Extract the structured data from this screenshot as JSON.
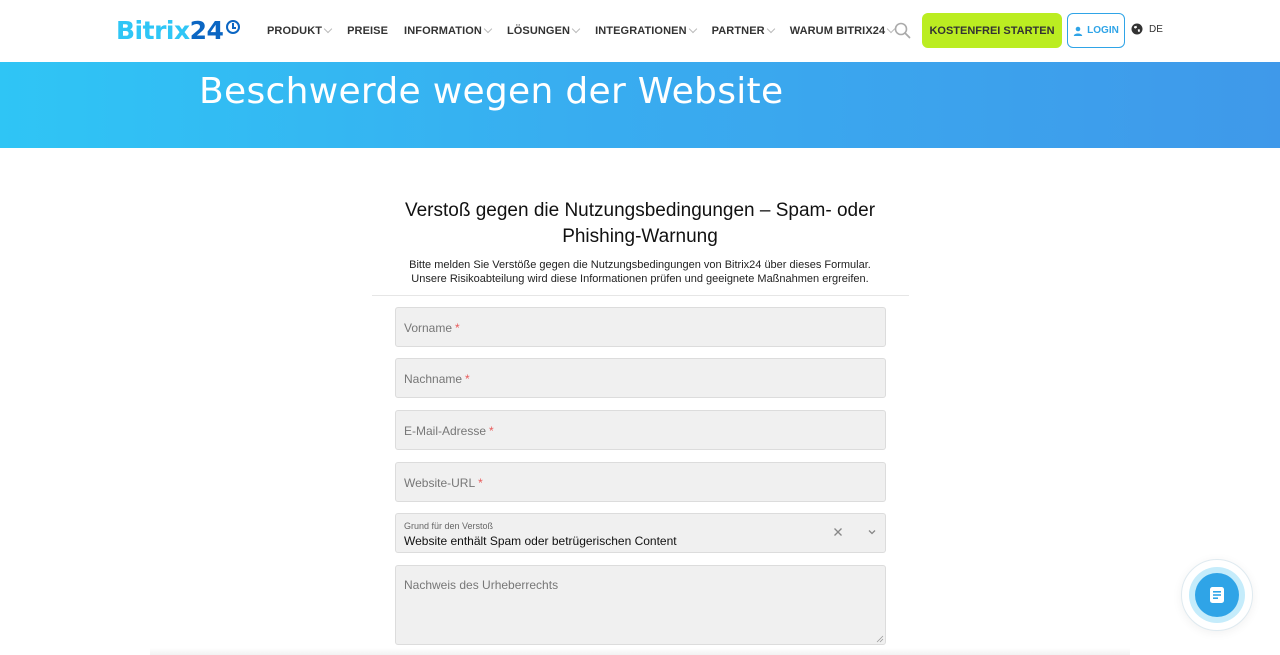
{
  "header": {
    "logo": {
      "part1": "Bitrix",
      "part2": "24"
    },
    "nav": [
      {
        "label": "PRODUKT",
        "dropdown": true
      },
      {
        "label": "PREISE",
        "dropdown": false
      },
      {
        "label": "INFORMATION",
        "dropdown": true
      },
      {
        "label": "LÖSUNGEN",
        "dropdown": true
      },
      {
        "label": "INTEGRATIONEN",
        "dropdown": true
      },
      {
        "label": "PARTNER",
        "dropdown": true
      },
      {
        "label": "WARUM BITRIX24",
        "dropdown": true
      }
    ],
    "cta_label": "KOSTENFREI STARTEN",
    "login_label": "LOGIN",
    "language": "DE"
  },
  "banner": {
    "title": "Beschwerde wegen der Website"
  },
  "form": {
    "title": "Verstoß gegen die Nutzungsbedingungen – Spam- oder Phishing-Warnung",
    "description_line1": "Bitte melden Sie Verstöße gegen die Nutzungsbedingungen von Bitrix24 über dieses Formular.",
    "description_line2": "Unsere Risikoabteilung wird diese Informationen prüfen und geeignete Maßnahmen ergreifen.",
    "required_mark": "*",
    "fields": {
      "first_name": "Vorname",
      "last_name": "Nachname",
      "email": "E-Mail-Adresse",
      "website": "Website-URL"
    },
    "reason": {
      "label": "Grund für den Verstoß",
      "value": "Website enthält Spam oder betrügerischen Content"
    },
    "copyright_placeholder": "Nachweis des Urheberrechts"
  },
  "colors": {
    "brand_light": "#2fc6f6",
    "brand_dark": "#0b66c3",
    "cta": "#bbed21",
    "accent": "#2fa4e7"
  },
  "icons": {
    "search": "search-icon",
    "user": "user-icon",
    "globe": "globe-icon",
    "clock": "clock-icon",
    "clear": "close-icon",
    "chevron": "chevron-down-icon",
    "chat": "chat-form-icon"
  }
}
